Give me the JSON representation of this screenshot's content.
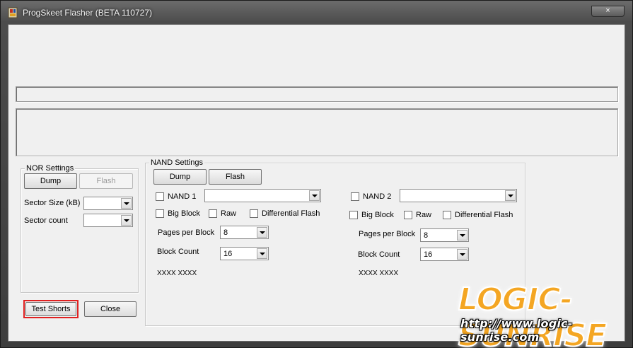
{
  "window": {
    "title": "ProgSkeet Flasher (BETA 110727)",
    "close_glyph": "×"
  },
  "nor": {
    "title": "NOR Settings",
    "dump_label": "Dump",
    "flash_label": "Flash",
    "sector_size_label": "Sector Size (kB)",
    "sector_size_value": "",
    "sector_count_label": "Sector count",
    "sector_count_value": ""
  },
  "nand": {
    "title": "NAND Settings",
    "dump_label": "Dump",
    "flash_label": "Flash",
    "nand1": {
      "label": "NAND 1",
      "select_value": "",
      "bigblock_label": "Big Block",
      "raw_label": "Raw",
      "diff_label": "Differential Flash",
      "pages_label": "Pages per Block",
      "pages_value": "8",
      "blockcount_label": "Block Count",
      "blockcount_value": "16",
      "id_text": "XXXX XXXX"
    },
    "nand2": {
      "label": "NAND 2",
      "select_value": "",
      "bigblock_label": "Big Block",
      "raw_label": "Raw",
      "diff_label": "Differential Flash",
      "pages_label": "Pages per Block",
      "pages_value": "8",
      "blockcount_label": "Block Count",
      "blockcount_value": "16",
      "id_text": "XXXX XXXX"
    }
  },
  "buttons": {
    "test_shorts_label": "Test Shorts",
    "close_label": "Close"
  },
  "watermark": {
    "logo_text": "LOGIC-SUNRISE",
    "url_text": "http://www.logic-sunrise.com"
  },
  "colors": {
    "highlight_border": "#e02020",
    "watermark_orange": "#f4a623"
  }
}
